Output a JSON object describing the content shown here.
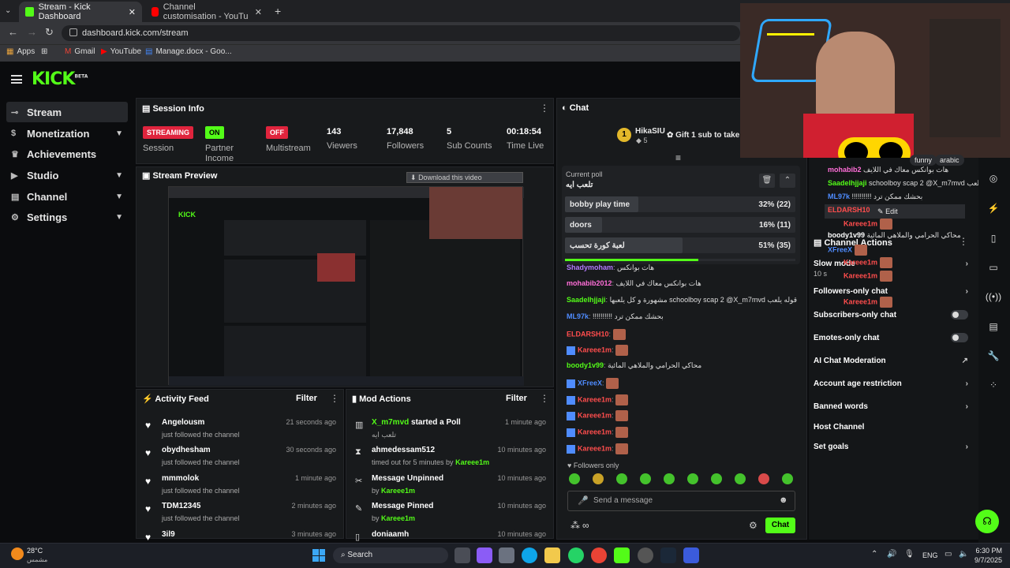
{
  "browser": {
    "tab1": "Stream - Kick Dashboard",
    "tab2": "Channel customisation - YouTu",
    "url": "dashboard.kick.com/stream",
    "bookmarks": [
      "Apps",
      "Gmail",
      "YouTube",
      "Manage.docx - Goo..."
    ]
  },
  "brand": {
    "logo": "KICK",
    "beta": "BETA",
    "accent": "#53fc18"
  },
  "sidebar": [
    {
      "label": "Stream",
      "icon": "link-icon"
    },
    {
      "label": "Monetization",
      "icon": "dollar-icon",
      "chev": "⌄"
    },
    {
      "label": "Achievements",
      "icon": "trophy-icon"
    },
    {
      "label": "Studio",
      "icon": "video-icon",
      "chev": "⌄"
    },
    {
      "label": "Channel",
      "icon": "channel-icon",
      "chev": "⌄"
    },
    {
      "label": "Settings",
      "icon": "gear-icon",
      "chev": "⌄"
    }
  ],
  "session": {
    "title": "Session Info",
    "streaming": "STREAMING",
    "session_label": "Session",
    "on": "ON",
    "partner": "Partner",
    "income": "Income",
    "off": "OFF",
    "multistream": "Multistream",
    "viewers": "143",
    "viewers_label": "Viewers",
    "followers": "17,848",
    "followers_label": "Followers",
    "subs": "5",
    "subs_label": "Sub Counts",
    "time": "00:18:54",
    "time_label": "Time Live"
  },
  "preview": {
    "title": "Stream Preview",
    "download": "Download this video"
  },
  "activity": {
    "title": "Activity Feed",
    "filter": "Filter",
    "items": [
      {
        "name": "Angelousm",
        "sub": "just followed the channel",
        "time": "21 seconds ago"
      },
      {
        "name": "obydhesham",
        "sub": "just followed the channel",
        "time": "30 seconds ago"
      },
      {
        "name": "mmmolok",
        "sub": "just followed the channel",
        "time": "1 minute ago"
      },
      {
        "name": "TDM12345",
        "sub": "just followed the channel",
        "time": "2 minutes ago"
      },
      {
        "name": "3il9",
        "sub": "",
        "time": "3 minutes ago"
      }
    ]
  },
  "mod": {
    "title": "Mod Actions",
    "filter": "Filter",
    "items": [
      {
        "name": "X_m7mvd",
        "rest": "started a Poll",
        "sub": "تلعب ايه",
        "time": "1 minute ago"
      },
      {
        "name": "ahmedessam512",
        "rest": "",
        "sub": "timed out for 5 minutes by",
        "by": "Kareee1m",
        "time": "10 minutes ago"
      },
      {
        "name": "Message Unpinned",
        "rest": "",
        "sub": "by",
        "by": "Kareee1m",
        "time": "10 minutes ago"
      },
      {
        "name": "Message Pinned",
        "rest": "",
        "sub": "by",
        "by": "Kareee1m",
        "time": "10 minutes ago"
      },
      {
        "name": "doniaamh",
        "rest": "",
        "sub": "",
        "time": "10 minutes ago"
      }
    ]
  },
  "chat": {
    "title": "Chat",
    "gifter": "HikaSIU",
    "gifter_count": "5",
    "gift_text": "Gift 1 sub to take 2",
    "poll_label": "Current poll",
    "poll_q": "تلعب ايه",
    "poll": [
      {
        "label": "bobby play time",
        "pct": "32% (22)",
        "frac": 0.32
      },
      {
        "label": "doors",
        "pct": "16% (11)",
        "frac": 0.16
      },
      {
        "label": "لعبة كورة تحسب",
        "pct": "51% (35)",
        "frac": 0.51
      }
    ],
    "messages": [
      {
        "name": "Shadymoham",
        "color": "#b57bff",
        "text": "هات بوانكس"
      },
      {
        "name": "mohabib2012",
        "color": "#ff6ed8",
        "text": "هات بوانكس معاك في اللايف"
      },
      {
        "name": "Saadelhjjaji",
        "color": "#53fc18",
        "text": "مشهورة و كل يلعبها schoolboy scap 2 @X_m7mvd قوله يلعب"
      },
      {
        "name": "ML97k",
        "color": "#4f8cff",
        "text": "!!!!!!!!!! بحشك ممكن ترد"
      },
      {
        "name": "ELDARSH10",
        "color": "#ff4d4d",
        "text": ""
      },
      {
        "name": "Kareee1m",
        "color": "#ff4d4d",
        "text": ""
      },
      {
        "name": "boody1v99",
        "color": "#53fc18",
        "text": "محاكي الحرامي والملاهي المائية"
      },
      {
        "name": "XFreeX",
        "color": "#4f8cff",
        "text": ""
      },
      {
        "name": "Kareee1m",
        "color": "#ff4d4d",
        "text": ""
      },
      {
        "name": "Kareee1m",
        "color": "#ff4d4d",
        "text": ""
      },
      {
        "name": "Kareee1m",
        "color": "#ff4d4d",
        "text": ""
      },
      {
        "name": "Kareee1m",
        "color": "#ff4d4d",
        "text": ""
      }
    ],
    "followers_only": "Followers only",
    "placeholder": "Send a message",
    "send": "Chat"
  },
  "actions": {
    "title": "Channel Actions",
    "slow": "Slow mode",
    "slow_sub": "10 s",
    "followers": "Followers-only chat",
    "subs": "Subscribers-only chat",
    "emotes": "Emotes-only chat",
    "ai": "AI Chat Moderation",
    "age": "Account age restriction",
    "banned": "Banned words",
    "host": "Host Channel",
    "goals": "Set goals",
    "overlay": {
      "m1name": "mohabib2",
      "m1text": "هات بوانكس معاك في اللايف",
      "m2name": "Saadelhjjaji",
      "m2text": "schoolboy scap 2 @X_m7mvd قوله يلعب",
      "m3name": "ML97k",
      "m3text": "!!!!!!!!!! بحشك ممكن ترد",
      "m4name": "ELDARSH10",
      "edit": "Edit",
      "m5": "Kareee1m",
      "m6name": "boody1v99",
      "m6text": "محاكي الحرامي والملاهي المائية",
      "m7": "XFreeX",
      "tag1": "funny",
      "tag2": "arabic"
    }
  },
  "taskbar": {
    "temp": "28°C",
    "weather": "مشمس",
    "search": "Search",
    "lang": "ENG",
    "time": "6:30 PM",
    "date": "9/7/2025"
  }
}
